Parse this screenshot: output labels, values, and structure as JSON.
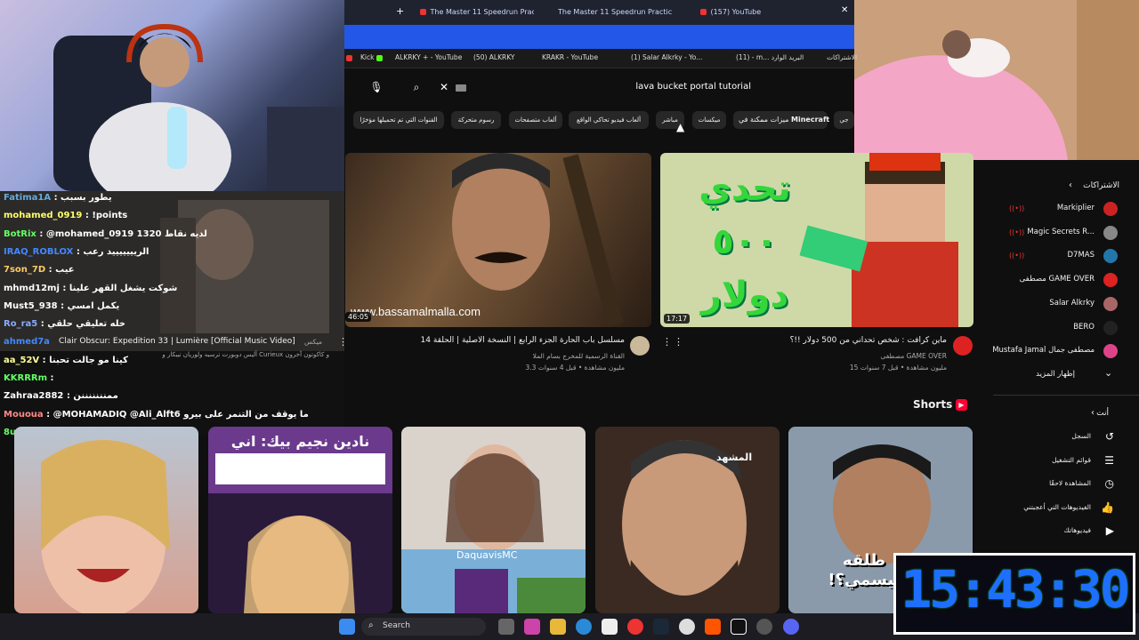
{
  "browser": {
    "tabs": [
      {
        "title": "The Master 11 Speedrun Practic"
      },
      {
        "title": "The Master 11 Speedrun Practic"
      },
      {
        "title": "(157) YouTube"
      }
    ],
    "bookmarks": [
      {
        "label": "Kick"
      },
      {
        "label": "ALKRKY + - YouTube"
      },
      {
        "label": "(50) ALKRKY"
      },
      {
        "label": "KRAKR - YouTube"
      },
      {
        "label": "(1) Salar Alkrky - Yo..."
      },
      {
        "label": "(11) - m... البريد الوارد"
      },
      {
        "label": "الاشتراكات"
      }
    ]
  },
  "youtube": {
    "search": {
      "query": "lava bucket portal tutorial"
    },
    "chips": [
      {
        "label": "القنوات التي تم تحميلها مؤخرًا"
      },
      {
        "label": "رسوم متحركة"
      },
      {
        "label": "ألعاب متصفحات"
      },
      {
        "label": "ألعاب فيديو تحاكي الواقع"
      },
      {
        "label": "مباشر"
      },
      {
        "label": "ميكسات"
      },
      {
        "label": "Minecraft"
      },
      {
        "label": "ميزات ممكنة في"
      },
      {
        "label": "جي"
      }
    ],
    "videos": [
      {
        "title": "مسلسل باب الحارة الجزء الرابع | النسخة الاصلية | الحلقة 14",
        "channel": "القناة الرسمية للمخرج بسام الملا",
        "meta": "3.3 مليون مشاهدة • قبل 4 سنوات",
        "duration": "46:05",
        "watermark": "www.bassamalmalla.com"
      },
      {
        "title": "ماين كرافت : شخص تحداني من 500 دولار !!؟",
        "channel": "مصطفى GAME OVER",
        "meta": "15 مليون مشاهدة • قبل 7 سنوات",
        "duration": "17:17",
        "thumb_text": "تحدي ٥٠٠ دولار"
      },
      {
        "title": "Clair Obscur: Expedition 33 | Lumière [Official Music Video]",
        "channel": "أليس دوبورت ترسيه ولوريان تيبكار و Curieux و كاكوتون آخرون",
        "meta": "ميكس"
      }
    ],
    "shorts_title": "Shorts",
    "shorts": [
      {
        "overlay": ""
      },
      {
        "overlay": "نادين نجيم بيك: اني مسيحية وأبي مسلم"
      },
      {
        "overlay": "DaquavisMC"
      },
      {
        "overlay": "المشهد"
      },
      {
        "overlay": "طلقه بيسمي؟!"
      }
    ],
    "sidebar": {
      "subscriptions_title": "الاشتراكات",
      "channels": [
        {
          "name": "Markiplier",
          "live": true
        },
        {
          "name": "Magic Secrets R...",
          "live": true
        },
        {
          "name": "D7MAS",
          "live": true
        },
        {
          "name": "مصطفى GAME OVER",
          "live": false
        },
        {
          "name": "Salar Alkrky",
          "live": false
        },
        {
          "name": "BERO",
          "live": false
        },
        {
          "name": "Mustafa Jamal مصطفى جمال",
          "live": false
        }
      ],
      "show_more": "إظهار المزيد",
      "you_title": "أنت",
      "you_items": [
        {
          "label": "السجل"
        },
        {
          "label": "قوائم التشغيل"
        },
        {
          "label": "المشاهدة لاحقًا"
        },
        {
          "label": "الفيديوهات التي أعجبتني"
        },
        {
          "label": "فيديوهاتك"
        }
      ]
    }
  },
  "chat": [
    {
      "user": "Fatima1A",
      "msg": ": يطور بسبب",
      "color": "#6ad"
    },
    {
      "user": "mohamed_0919",
      "msg": ": !points",
      "color": "#ff6"
    },
    {
      "user": "BotRix",
      "msg": ": @mohamed_0919 1320 لديه نقاط",
      "color": "#6f6"
    },
    {
      "user": "IRAQ_ROBLOX",
      "msg": ": الريييييييد رعب",
      "color": "#48f"
    },
    {
      "user": "7son_7D",
      "msg": ": عيب",
      "color": "#fc6"
    },
    {
      "user": "mhmd12mj",
      "msg": ": شوكت يشغل القهر علينا",
      "color": "#fff"
    },
    {
      "user": "Must5_938",
      "msg": ": يكمل امسي",
      "color": "#fff"
    },
    {
      "user": "Ro_ra5",
      "msg": ": خله تعليقي حلقي",
      "color": "#8af"
    },
    {
      "user": "ahmed7a",
      "msg": "",
      "color": "#48f"
    },
    {
      "user": "aa_52V",
      "msg": ": كينا مو جالت تحبنا",
      "color": "#ff9"
    },
    {
      "user": "KKRRRm",
      "msg": ":",
      "color": "#6f6"
    },
    {
      "user": "Zahraa2882",
      "msg": ": ممنننننننن",
      "color": "#fff"
    },
    {
      "user": "Mououa",
      "msg": ": @MOHAMADIQ @Ali_Alft6 ما يوقف من التنمر على بيرو",
      "color": "#f88"
    },
    {
      "user": "8ud_1",
      "msg": ": ادخل سيرفر موتي وكارتون",
      "color": "#6f6"
    }
  ],
  "taskbar": {
    "search_label": "Search"
  },
  "clock": {
    "time": "15:43:30"
  }
}
